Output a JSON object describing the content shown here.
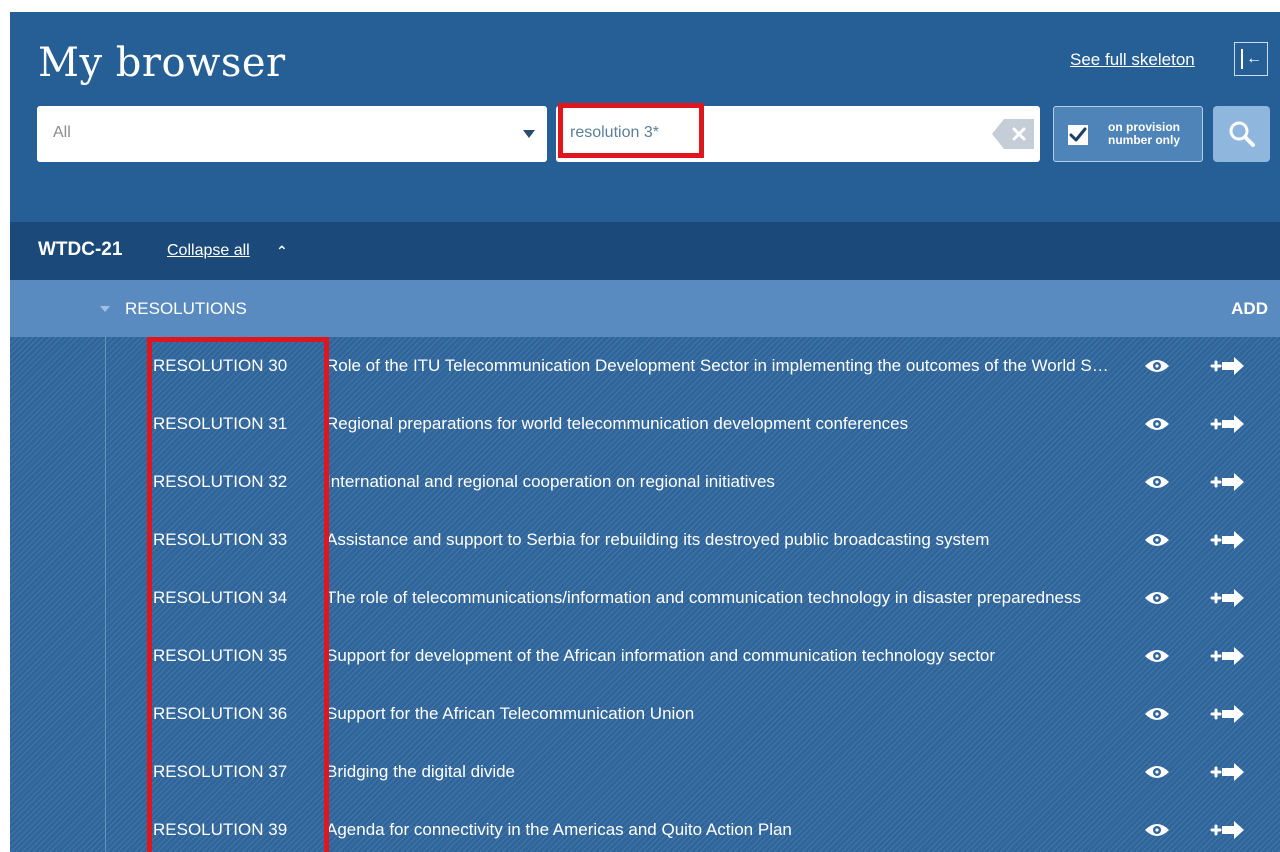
{
  "header": {
    "title": "My browser",
    "see_full_label": "See full skeleton",
    "collapse_icon": "panel-collapse-icon"
  },
  "search": {
    "scope_value": "All",
    "query": "resolution 3*",
    "clear_icon": "clear-x-icon",
    "provision_checked": true,
    "provision_label_line1": "on provision",
    "provision_label_line2": "number only",
    "search_icon": "magnifier-icon"
  },
  "tree": {
    "name": "WTDC-21",
    "collapse_all_label": "Collapse all",
    "collapse_all_icon": "double-chevron-up-icon"
  },
  "section": {
    "label": "RESOLUTIONS",
    "add_label": "ADD"
  },
  "colors": {
    "panel": "#265f95",
    "tree_header": "#1b4a7a",
    "section_row": "#5a8bc0",
    "highlight": "#e0161f"
  },
  "items": [
    {
      "id": "RESOLUTION 30",
      "title": "Role of the ITU Telecommunication Development Sector in implementing the outcomes of the World Summit on the Information Society"
    },
    {
      "id": "RESOLUTION 31",
      "title": "Regional preparations for world telecommunication development conferences"
    },
    {
      "id": "RESOLUTION 32",
      "title": "International and regional cooperation on regional initiatives"
    },
    {
      "id": "RESOLUTION 33",
      "title": "Assistance and support to Serbia for rebuilding its destroyed public broadcasting system"
    },
    {
      "id": "RESOLUTION 34",
      "title": "The role of telecommunications/information and communication technology in disaster preparedness"
    },
    {
      "id": "RESOLUTION 35",
      "title": "Support for development of the African information and communication technology sector"
    },
    {
      "id": "RESOLUTION 36",
      "title": "Support for the African Telecommunication Union"
    },
    {
      "id": "RESOLUTION 37",
      "title": "Bridging the digital divide"
    },
    {
      "id": "RESOLUTION 39",
      "title": "Agenda for connectivity in the Americas and Quito Action Plan"
    }
  ]
}
